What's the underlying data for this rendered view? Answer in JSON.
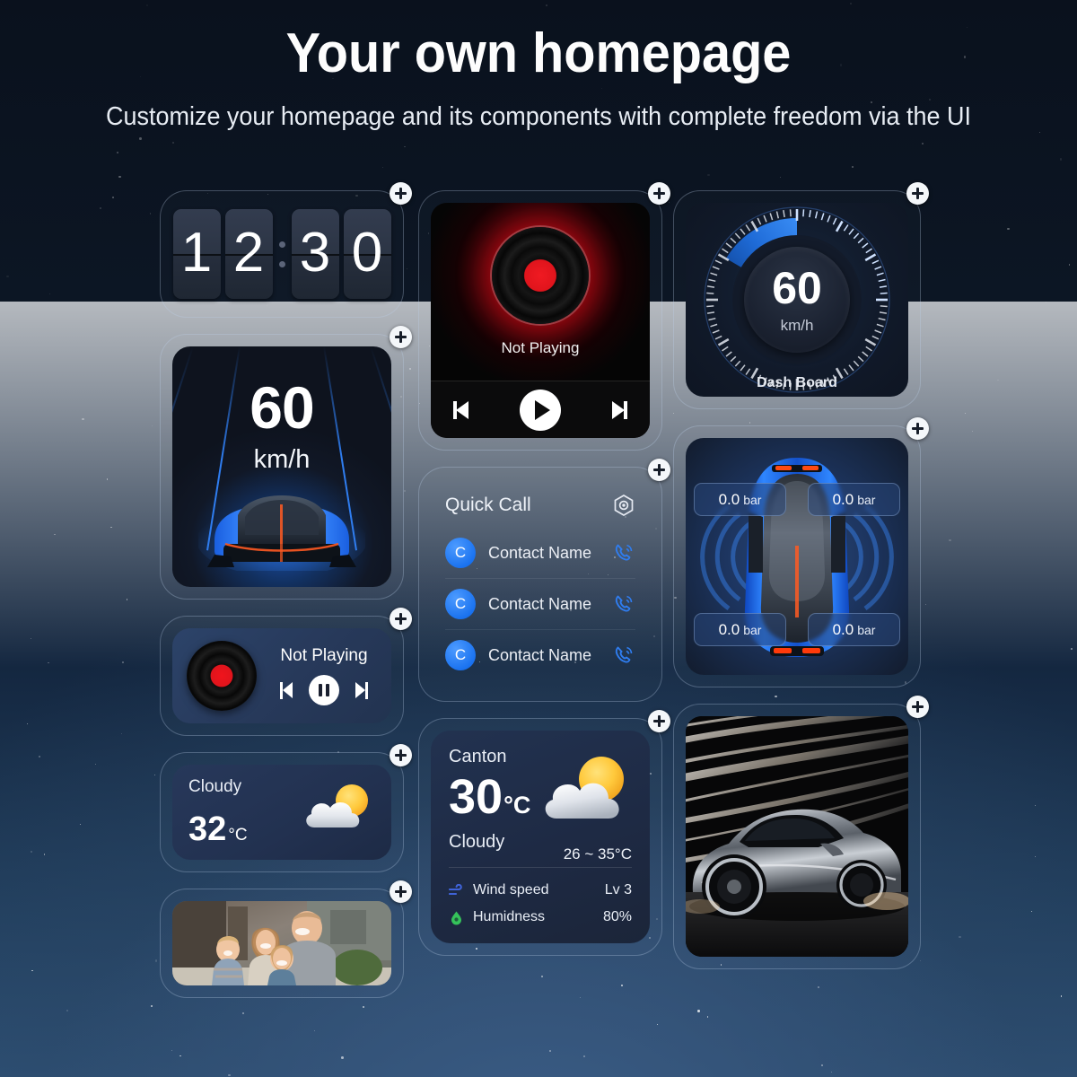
{
  "header": {
    "title": "Your own homepage",
    "subtitle": "Customize your homepage and its components with complete freedom via the UI"
  },
  "colors": {
    "accent_blue": "#2f7df0",
    "avatar_blue": "#1b73f0",
    "vinyl_red": "#e0141c",
    "sun_yellow": "#ffc93c",
    "humidity_green": "#35c25a",
    "plus_button": "#f4f7fa",
    "background_top": "#0a111d",
    "background_bottom": "#2d4f73"
  },
  "widgets": {
    "clock": {
      "name": "Flip Clock",
      "digits": [
        "1",
        "2",
        "3",
        "0"
      ],
      "time": "12:30",
      "add_icon": "plus-icon"
    },
    "music_big": {
      "name": "Music Player",
      "status": "Not Playing",
      "controls": [
        "previous-icon",
        "play-icon",
        "next-icon"
      ],
      "add_icon": "plus-icon"
    },
    "dashboard": {
      "name": "Dash Board",
      "value": "60",
      "unit": "km/h",
      "label": "Dash Board",
      "gauge_percent": 25,
      "add_icon": "plus-icon"
    },
    "speed": {
      "name": "Speed",
      "value": "60",
      "unit": "km/h",
      "add_icon": "plus-icon"
    },
    "quick_call": {
      "name": "Quick Call",
      "title": "Quick Call",
      "settings_icon": "hex-settings-icon",
      "contacts": [
        {
          "initial": "C",
          "name": "Contact Name",
          "call_icon": "phone-ring-icon"
        },
        {
          "initial": "C",
          "name": "Contact Name",
          "call_icon": "phone-ring-icon"
        },
        {
          "initial": "C",
          "name": "Contact Name",
          "call_icon": "phone-ring-icon"
        }
      ],
      "add_icon": "plus-icon"
    },
    "tire_pressure": {
      "name": "Tire Pressure",
      "tires": [
        {
          "position": "front-left",
          "value": "0.0",
          "unit": "bar"
        },
        {
          "position": "front-right",
          "value": "0.0",
          "unit": "bar"
        },
        {
          "position": "rear-left",
          "value": "0.0",
          "unit": "bar"
        },
        {
          "position": "rear-right",
          "value": "0.0",
          "unit": "bar"
        }
      ],
      "add_icon": "plus-icon"
    },
    "music_small": {
      "name": "Music Mini",
      "status": "Not Playing",
      "controls": [
        "previous-icon",
        "pause-icon",
        "next-icon"
      ],
      "add_icon": "plus-icon"
    },
    "weather_small": {
      "name": "Weather Mini",
      "condition": "Cloudy",
      "temperature": "32",
      "unit": "°C",
      "icon": "sun-behind-cloud-icon",
      "add_icon": "plus-icon"
    },
    "weather_big": {
      "name": "Weather",
      "city": "Canton",
      "temperature": "30",
      "unit": "°C",
      "range": "26 ~ 35°C",
      "condition": "Cloudy",
      "icon": "sun-behind-cloud-icon",
      "details": [
        {
          "icon": "wind-icon",
          "label": "Wind speed",
          "value": "Lv 3"
        },
        {
          "icon": "humidity-icon",
          "label": "Humidness",
          "value": "80%"
        }
      ],
      "add_icon": "plus-icon"
    },
    "photo": {
      "name": "Family Photo",
      "alt": "family photo of four people outdoors",
      "add_icon": "plus-icon"
    },
    "car_photo": {
      "name": "Car Photo",
      "alt": "silver sports car with motion light trails",
      "add_icon": "plus-icon"
    }
  }
}
